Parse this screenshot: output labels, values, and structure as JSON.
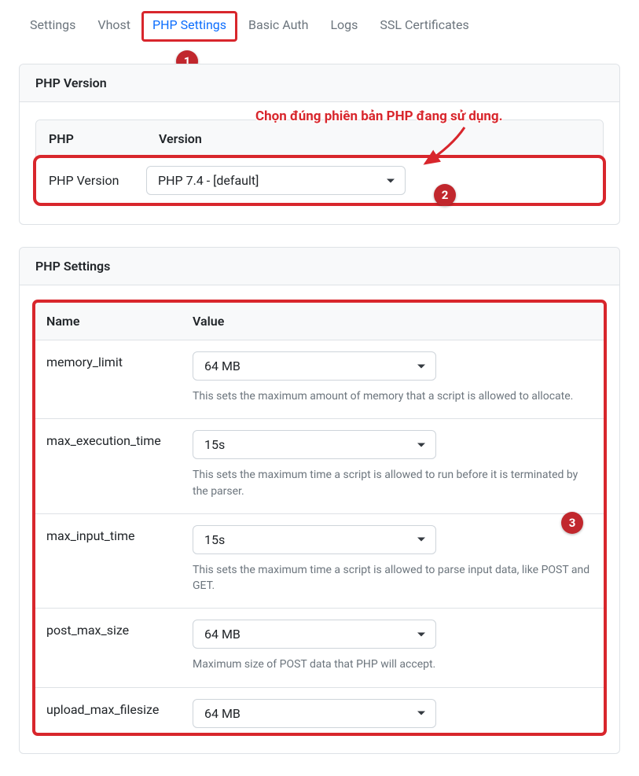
{
  "tabs": [
    {
      "label": "Settings"
    },
    {
      "label": "Vhost"
    },
    {
      "label": "PHP Settings"
    },
    {
      "label": "Basic Auth"
    },
    {
      "label": "Logs"
    },
    {
      "label": "SSL Certificates"
    }
  ],
  "annotation": {
    "text": "Chọn đúng phiên bản PHP đang sử dụng.",
    "badges": {
      "one": "1",
      "two": "2",
      "three": "3"
    }
  },
  "version_panel": {
    "title": "PHP Version",
    "head_col1": "PHP",
    "head_col2": "Version",
    "row_label": "PHP Version",
    "select_value": "PHP 7.4 - [default]"
  },
  "settings_panel": {
    "title": "PHP Settings",
    "head_name": "Name",
    "head_value": "Value",
    "rows": [
      {
        "name": "memory_limit",
        "value": "64 MB",
        "help": "This sets the maximum amount of memory that a script is allowed to allocate."
      },
      {
        "name": "max_execution_time",
        "value": "15s",
        "help": "This sets the maximum time a script is allowed to run before it is terminated by the parser."
      },
      {
        "name": "max_input_time",
        "value": "15s",
        "help": "This sets the maximum time a script is allowed to parse input data, like POST and GET."
      },
      {
        "name": "post_max_size",
        "value": "64 MB",
        "help": "Maximum size of POST data that PHP will accept."
      },
      {
        "name": "upload_max_filesize",
        "value": "64 MB",
        "help": ""
      }
    ]
  }
}
